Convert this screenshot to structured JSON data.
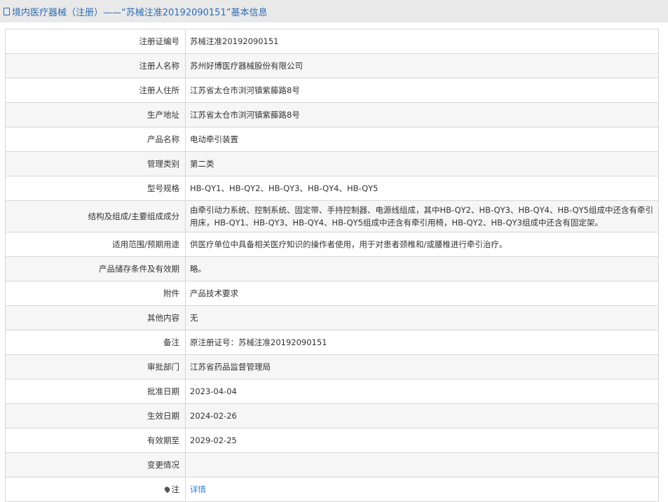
{
  "header": {
    "title": "境内医疗器械（注册）——“苏械注准20192090151”基本信息"
  },
  "rows": [
    {
      "label": "注册证编号",
      "value": "苏械注准20192090151"
    },
    {
      "label": "注册人名称",
      "value": "苏州好博医疗器械股份有限公司"
    },
    {
      "label": "注册人住所",
      "value": "江苏省太仓市浏河镇紫藤路8号"
    },
    {
      "label": "生产地址",
      "value": "江苏省太仓市浏河镇紫藤路8号"
    },
    {
      "label": "产品名称",
      "value": "电动牵引装置"
    },
    {
      "label": "管理类别",
      "value": "第二类"
    },
    {
      "label": "型号规格",
      "value": "HB-QY1、HB-QY2、HB-QY3、HB-QY4、HB-QY5"
    },
    {
      "label": "结构及组成/主要组成成分",
      "value": "由牵引动力系统、控制系统、固定带、手持控制器、电源线组成，其中HB-QY2、HB-QY3、HB-QY4、HB-QY5组成中还含有牵引用床，HB-QY1、HB-QY3、HB-QY4、HB-QY5组成中还含有牵引用椅，HB-QY2、HB-QY3组成中还含有固定架。"
    },
    {
      "label": "适用范围/预期用途",
      "value": "供医疗单位中具备相关医疗知识的操作者使用，用于对患者颈椎和/或腰椎进行牵引治疗。"
    },
    {
      "label": "产品储存条件及有效期",
      "value": "略。"
    },
    {
      "label": "附件",
      "value": "产品技术要求"
    },
    {
      "label": "其他内容",
      "value": "无"
    },
    {
      "label": "备注",
      "value": "原注册证号：苏械注准20192090151"
    },
    {
      "label": "审批部门",
      "value": "江苏省药品监督管理局"
    },
    {
      "label": "批准日期",
      "value": "2023-04-04"
    },
    {
      "label": "生效日期",
      "value": "2024-02-26"
    },
    {
      "label": "有效期至",
      "value": "2029-02-25"
    },
    {
      "label": "变更情况",
      "value": ""
    }
  ],
  "note": {
    "label": "注",
    "link": "详情"
  }
}
